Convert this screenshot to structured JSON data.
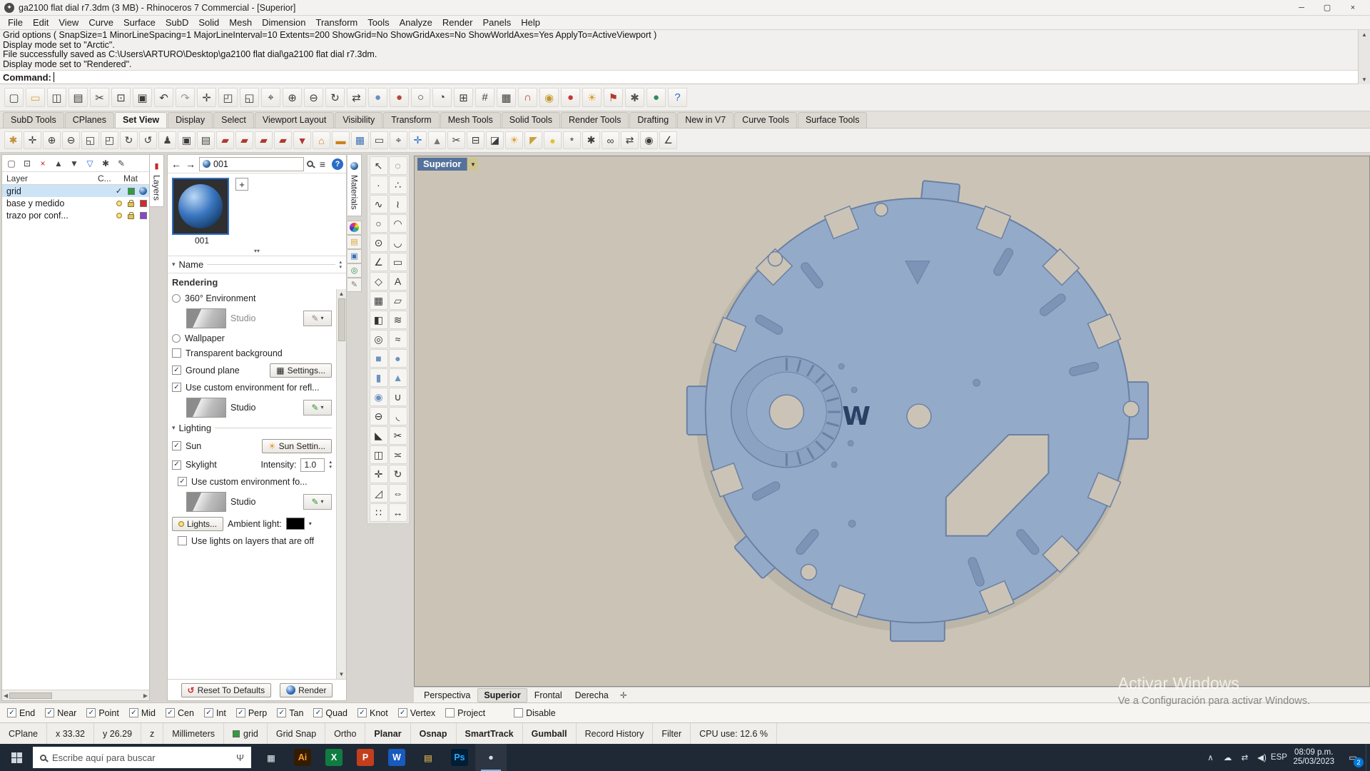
{
  "theme": {
    "vpbg": "#cbc4b6",
    "dial": "#94aac9",
    "dialEdge": "#6b80a3",
    "dialDark": "#7e94b6",
    "dialShade": "#8ba2c3",
    "sel": "#cde4f7"
  },
  "window": {
    "title": "ga2100 flat dial r7.3dm (3 MB) - Rhinoceros 7 Commercial - [Superior]",
    "controls": [
      {
        "n": "minimize-button",
        "g": "─"
      },
      {
        "n": "maximize-button",
        "g": "▢"
      },
      {
        "n": "close-button",
        "g": "×"
      }
    ]
  },
  "menu": {
    "items": [
      "File",
      "Edit",
      "View",
      "Curve",
      "Surface",
      "SubD",
      "Solid",
      "Mesh",
      "Dimension",
      "Transform",
      "Tools",
      "Analyze",
      "Render",
      "Panels",
      "Help"
    ]
  },
  "command_area": {
    "history": [
      "Grid options ( SnapSize=1  MinorLineSpacing=1  MajorLineInterval=10  Extents=200  ShowGrid=No  ShowGridAxes=No  ShowWorldAxes=Yes  ApplyTo=ActiveViewport )",
      "Display mode set to \"Arctic\".",
      "File successfully saved as C:\\Users\\ARTURO\\Desktop\\ga2100 flat dial\\ga2100 flat dial r7.3dm.",
      "Display mode set to \"Rendered\"."
    ],
    "prompt": "Command:"
  },
  "toolbar_main": {
    "icons": [
      {
        "n": "new-file-icon",
        "g": "▢"
      },
      {
        "n": "open-file-icon",
        "g": "▭",
        "c": "#d9a43b"
      },
      {
        "n": "save-file-icon",
        "g": "◫"
      },
      {
        "n": "print-icon",
        "g": "▤"
      },
      {
        "n": "cut-icon",
        "g": "✂"
      },
      {
        "n": "copy-icon",
        "g": "⊡"
      },
      {
        "n": "paste-icon",
        "g": "▣"
      },
      {
        "n": "undo-icon",
        "g": "↶"
      },
      {
        "n": "redo-icon",
        "g": "↷",
        "c": "#9a9a9a"
      },
      {
        "n": "pan-icon",
        "g": "✛"
      },
      {
        "n": "zoom-extents-icon",
        "g": "◰"
      },
      {
        "n": "zoom-window-icon",
        "g": "◱"
      },
      {
        "n": "zoom-target-icon",
        "g": "⌖"
      },
      {
        "n": "zoom-in-icon",
        "g": "⊕"
      },
      {
        "n": "zoom-out-icon",
        "g": "⊖"
      },
      {
        "n": "rotate-view-icon",
        "g": "↻"
      },
      {
        "n": "pan-view-icon",
        "g": "⇄"
      },
      {
        "n": "shaded-display-icon",
        "g": "●",
        "c": "#6b8fc2"
      },
      {
        "n": "rendered-display-icon",
        "g": "●",
        "c": "#b5483a"
      },
      {
        "n": "wireframe-display-icon",
        "g": "○"
      },
      {
        "n": "ghosted-display-icon",
        "g": "◔"
      },
      {
        "n": "four-viewport-icon",
        "g": "⊞"
      },
      {
        "n": "cplane-icon",
        "g": "#"
      },
      {
        "n": "grid-icon",
        "g": "▦"
      },
      {
        "n": "magnet-osnap-icon",
        "g": "∩",
        "c": "#c0392b"
      },
      {
        "n": "gumball-toggle-icon",
        "g": "◉",
        "c": "#c59a2f"
      },
      {
        "n": "record-history-icon",
        "g": "●",
        "c": "#cc3333"
      },
      {
        "n": "sun-icon",
        "g": "☀",
        "c": "#e09b2d"
      },
      {
        "n": "flag-icon",
        "g": "⚑",
        "c": "#b03a2e"
      },
      {
        "n": "gear-icon",
        "g": "✱",
        "c": "#555555"
      },
      {
        "n": "earth-icon",
        "g": "●",
        "c": "#2e8b57"
      },
      {
        "n": "help-icon",
        "g": "?",
        "c": "#2b6cc8"
      }
    ]
  },
  "tab_bar": {
    "tabs": [
      {
        "label": "SubD Tools"
      },
      {
        "label": "CPlanes"
      },
      {
        "label": "Set View",
        "cls": "active"
      },
      {
        "label": "Display"
      },
      {
        "label": "Select"
      },
      {
        "label": "Viewport Layout"
      },
      {
        "label": "Visibility"
      },
      {
        "label": "Transform"
      },
      {
        "label": "Mesh Tools"
      },
      {
        "label": "Solid Tools"
      },
      {
        "label": "Render Tools"
      },
      {
        "label": "Drafting"
      },
      {
        "label": "New in V7"
      },
      {
        "label": "Curve Tools"
      },
      {
        "label": "Surface Tools"
      }
    ]
  },
  "toolbar_secondary": {
    "icons": [
      {
        "n": "pan-hand-icon",
        "g": "✱",
        "c": "#c28e3a"
      },
      {
        "n": "move-view-icon",
        "g": "✛"
      },
      {
        "n": "zoom-dynamic-icon",
        "g": "⊕"
      },
      {
        "n": "zoom-out-view-icon",
        "g": "⊖"
      },
      {
        "n": "zoom-region-icon",
        "g": "◱"
      },
      {
        "n": "zoom-extents-view-icon",
        "g": "◰"
      },
      {
        "n": "rotate-camera-icon",
        "g": "↻"
      },
      {
        "n": "roll-camera-icon",
        "g": "↺"
      },
      {
        "n": "walk-mode-icon",
        "g": "♟",
        "c": "#444444"
      },
      {
        "n": "camera-icon",
        "g": "▣"
      },
      {
        "n": "named-views-icon",
        "g": "▤"
      },
      {
        "n": "red-display-a-icon",
        "g": "▰",
        "c": "#b03a2e"
      },
      {
        "n": "red-display-b-icon",
        "g": "▰",
        "c": "#b03a2e"
      },
      {
        "n": "red-display-c-icon",
        "g": "▰",
        "c": "#b03a2e"
      },
      {
        "n": "red-display-d-icon",
        "g": "▰",
        "c": "#b03a2e"
      },
      {
        "n": "truck-view-icon",
        "g": "▼",
        "c": "#b03a2e"
      },
      {
        "n": "building-icon",
        "g": "⌂",
        "c": "#c9821f"
      },
      {
        "n": "ground-icon",
        "g": "▬",
        "c": "#c9821f"
      },
      {
        "n": "photo-icon",
        "g": "▦",
        "c": "#3b6fb5"
      },
      {
        "n": "screen-icon",
        "g": "▭"
      },
      {
        "n": "target-icon",
        "g": "⌖"
      },
      {
        "n": "compass-icon",
        "g": "✛",
        "c": "#2b6cc8"
      },
      {
        "n": "north-arrow-icon",
        "g": "▲",
        "c": "#777777"
      },
      {
        "n": "clipping-plane-icon",
        "g": "✂"
      },
      {
        "n": "section-icon",
        "g": "⊟"
      },
      {
        "n": "shadow-icon",
        "g": "◪"
      },
      {
        "n": "sun-study-icon",
        "g": "☀",
        "c": "#e09b2d"
      },
      {
        "n": "spotlight-icon",
        "g": "◤",
        "c": "#c9a23c"
      },
      {
        "n": "lamp-icon",
        "g": "●",
        "c": "#e0c23a"
      },
      {
        "n": "stars-icon",
        "g": "*"
      },
      {
        "n": "settings-view-icon",
        "g": "✱"
      },
      {
        "n": "link-icon",
        "g": "∞"
      },
      {
        "n": "sync-icon",
        "g": "⇄"
      },
      {
        "n": "lock-view-icon",
        "g": "◉"
      },
      {
        "n": "tilt-icon",
        "g": "∠"
      }
    ]
  },
  "layers_panel": {
    "toolbar": [
      {
        "n": "new-layer-icon",
        "g": "▢"
      },
      {
        "n": "new-sublayer-icon",
        "g": "⊡"
      },
      {
        "n": "delete-layer-icon",
        "g": "×",
        "c": "#cc2222"
      },
      {
        "n": "move-up-icon",
        "g": "▲"
      },
      {
        "n": "move-down-icon",
        "g": "▼"
      },
      {
        "n": "filter-icon",
        "g": "▽",
        "c": "#2b6cc8"
      },
      {
        "n": "layer-tools-icon",
        "g": "✱"
      },
      {
        "n": "match-properties-icon",
        "g": "✎"
      }
    ],
    "columns": [
      "Layer",
      "C...",
      "Mat"
    ],
    "rows": [
      {
        "name": "grid",
        "mark": "✓",
        "color": "#2e9e3e",
        "sphere": true,
        "cls": "sel"
      },
      {
        "name": "base y medido",
        "bulb": true,
        "lock": true,
        "color": "#d42a2a"
      },
      {
        "name": "trazo por conf...",
        "bulb": true,
        "lock": true,
        "color": "#8a46c8"
      }
    ]
  },
  "panel_tabs": {
    "layers_tab": "Layers",
    "materials_tab": "Materials",
    "side_icons": [
      {
        "n": "rendered-ball-tab-icon",
        "cls": "rainbow",
        "g": ""
      },
      {
        "n": "folder-tab-icon",
        "g": "▤",
        "c": "#d9a43b"
      },
      {
        "n": "image-tab-icon",
        "g": "▣",
        "c": "#3b6fb5"
      },
      {
        "n": "environment-tab-icon",
        "g": "◎",
        "c": "#2e8b57"
      },
      {
        "n": "paint-tab-icon",
        "g": "✎",
        "c": "#777777"
      }
    ]
  },
  "materials_panel": {
    "nav": {
      "back": "←",
      "forward": "→",
      "search_value": "001",
      "menu_icon": "≡",
      "help_icon": "?"
    },
    "thumb_label": "001",
    "add_label": "+",
    "collapse_glyph": "▾▾",
    "name_chev": "▾",
    "name_section": "Name",
    "up_glyph": "▴",
    "down_glyph": "▾",
    "rendering_section": "Rendering",
    "rendering": {
      "env360": {
        "label": "360° Environment"
      },
      "env_name1": "Studio",
      "wallpaper": {
        "label": "Wallpaper"
      },
      "transparent": {
        "label": "Transparent background",
        "mark": ""
      },
      "ground": {
        "label": "Ground plane",
        "mark": "✓",
        "button": "Settings..."
      },
      "custom_refl": {
        "label": "Use custom environment for refl...",
        "mark": "✓"
      },
      "env_name2": "Studio",
      "lighting_label": "Lighting",
      "sun": {
        "label": "Sun",
        "mark": "✓",
        "button": "Sun Settin..."
      },
      "skylight": {
        "label": "Skylight",
        "mark": "✓",
        "intensity_label": "Intensity:",
        "intensity": "1.0"
      },
      "custom_sky": {
        "label": "Use custom environment fo...",
        "mark": "✓"
      },
      "env_name3": "Studio",
      "lights_button": "Lights...",
      "ambient_label": "Ambient light:",
      "lights_off": {
        "label": "Use lights on layers that are off",
        "mark": ""
      }
    },
    "footer": {
      "reset": "Reset To Defaults",
      "render": "Render"
    }
  },
  "side_toolbar": {
    "icons": [
      {
        "n": "select-tool-icon",
        "g": "↖"
      },
      {
        "n": "lasso-tool-icon",
        "g": "◌"
      },
      {
        "n": "point-tool-icon",
        "g": "∙"
      },
      {
        "n": "points-tool-icon",
        "g": "∴"
      },
      {
        "n": "curve-tool-icon",
        "g": "∿"
      },
      {
        "n": "interp-curve-tool-icon",
        "g": "≀"
      },
      {
        "n": "circle-tool-icon",
        "g": "○"
      },
      {
        "n": "arc-tool-icon",
        "g": "◠"
      },
      {
        "n": "ellipse-tool-icon",
        "g": "⊙"
      },
      {
        "n": "conic-tool-icon",
        "g": "◡"
      },
      {
        "n": "polyline-tool-icon",
        "g": "∠"
      },
      {
        "n": "rectangle-tool-icon",
        "g": "▭"
      },
      {
        "n": "polygon-tool-icon",
        "g": "◇"
      },
      {
        "n": "text-tool-icon",
        "g": "A"
      },
      {
        "n": "surface-tool-icon",
        "g": "▦"
      },
      {
        "n": "plane-tool-icon",
        "g": "▱"
      },
      {
        "n": "extrude-tool-icon",
        "g": "◧"
      },
      {
        "n": "loft-tool-icon",
        "g": "≋"
      },
      {
        "n": "revolve-tool-icon",
        "g": "◎"
      },
      {
        "n": "sweep-tool-icon",
        "g": "≈"
      },
      {
        "n": "box-tool-icon",
        "g": "■",
        "c": "#6e93c0"
      },
      {
        "n": "sphere-tool-icon",
        "g": "●",
        "c": "#6e93c0"
      },
      {
        "n": "cylinder-tool-icon",
        "g": "▮",
        "c": "#6e93c0"
      },
      {
        "n": "cone-tool-icon",
        "g": "▲",
        "c": "#6e93c0"
      },
      {
        "n": "torus-tool-icon",
        "g": "◉",
        "c": "#6e93c0"
      },
      {
        "n": "boolean-union-icon",
        "g": "∪"
      },
      {
        "n": "boolean-difference-icon",
        "g": "⊖"
      },
      {
        "n": "fillet-tool-icon",
        "g": "◟"
      },
      {
        "n": "chamfer-tool-icon",
        "g": "◣"
      },
      {
        "n": "trim-tool-icon",
        "g": "✂"
      },
      {
        "n": "split-tool-icon",
        "g": "◫"
      },
      {
        "n": "join-tool-icon",
        "g": "≍"
      },
      {
        "n": "move-tool-icon",
        "g": "✛"
      },
      {
        "n": "rotate-tool-icon",
        "g": "↻"
      },
      {
        "n": "scale-tool-icon",
        "g": "◿"
      },
      {
        "n": "mirror-tool-icon",
        "g": "⇔"
      },
      {
        "n": "array-tool-icon",
        "g": "∷"
      },
      {
        "n": "dimension-tool-icon",
        "g": "↔"
      }
    ]
  },
  "viewport": {
    "title": "Superior",
    "caret_icon": "▼",
    "dial_letter": "W"
  },
  "activation": {
    "line1": "Activar Windows",
    "line2": "Ve a Configuración para activar Windows."
  },
  "viewport_tabs": {
    "tabs": [
      {
        "label": "Perspectiva"
      },
      {
        "label": "Superior",
        "cls": "active"
      },
      {
        "label": "Frontal"
      },
      {
        "label": "Derecha"
      }
    ],
    "move_icon": "✛"
  },
  "osnap_bar": {
    "items": [
      {
        "label": "End",
        "mark": "✓"
      },
      {
        "label": "Near",
        "mark": "✓"
      },
      {
        "label": "Point",
        "mark": "✓"
      },
      {
        "label": "Mid",
        "mark": "✓"
      },
      {
        "label": "Cen",
        "mark": "✓"
      },
      {
        "label": "Int",
        "mark": "✓"
      },
      {
        "label": "Perp",
        "mark": "✓"
      },
      {
        "label": "Tan",
        "mark": "✓"
      },
      {
        "label": "Quad",
        "mark": "✓"
      },
      {
        "label": "Knot",
        "mark": "✓"
      },
      {
        "label": "Vertex",
        "mark": "✓"
      },
      {
        "label": "Project",
        "mark": ""
      }
    ],
    "disable": {
      "label": "Disable",
      "mark": ""
    }
  },
  "status_bar": {
    "items": [
      {
        "label": "CPlane"
      },
      {
        "label": "x 33.32"
      },
      {
        "label": "y 26.29"
      },
      {
        "label": "z"
      },
      {
        "label": "Millimeters"
      },
      {
        "label": "grid",
        "swatch": "#2e9e3e"
      },
      {
        "label": "Grid Snap"
      },
      {
        "label": "Ortho"
      },
      {
        "label": "Planar",
        "cls": "bold"
      },
      {
        "label": "Osnap",
        "cls": "bold"
      },
      {
        "label": "SmartTrack",
        "cls": "bold"
      },
      {
        "label": "Gumball",
        "cls": "bold"
      },
      {
        "label": "Record History"
      },
      {
        "label": "Filter"
      },
      {
        "label": "CPU use: 12.6 %"
      }
    ]
  },
  "taskbar": {
    "search_placeholder": "Escribe aquí para buscar",
    "mic_icon": "Ψ",
    "apps": [
      {
        "n": "task-view-button",
        "t": "▦",
        "fg": "#e8ecf1"
      },
      {
        "n": "illustrator-app",
        "t": "Ai",
        "bg": "#331c00",
        "fg": "#ff9a33"
      },
      {
        "n": "excel-app",
        "t": "X",
        "bg": "#107c41",
        "fg": "#ffffff"
      },
      {
        "n": "powerpoint-app",
        "t": "P",
        "bg": "#c43e1c",
        "fg": "#ffffff"
      },
      {
        "n": "word-app",
        "t": "W",
        "bg": "#185abd",
        "fg": "#ffffff"
      },
      {
        "n": "explorer-app",
        "t": "▤",
        "fg": "#f3c64b"
      },
      {
        "n": "photoshop-app",
        "t": "Ps",
        "bg": "#001e36",
        "fg": "#31a8ff"
      },
      {
        "n": "rhino-app",
        "t": "●",
        "fg": "#d8dde2",
        "cls": "running"
      }
    ],
    "tray": [
      {
        "n": "tray-expand-icon",
        "g": "∧"
      },
      {
        "n": "onedrive-icon",
        "g": "☁"
      },
      {
        "n": "network-icon",
        "g": "⇄"
      },
      {
        "n": "volume-icon",
        "g": "◀)"
      },
      {
        "n": "language-indicator",
        "g": "ESP"
      }
    ],
    "time": "08:09 p.m.",
    "date": "25/03/2023",
    "notification_count": "2"
  }
}
